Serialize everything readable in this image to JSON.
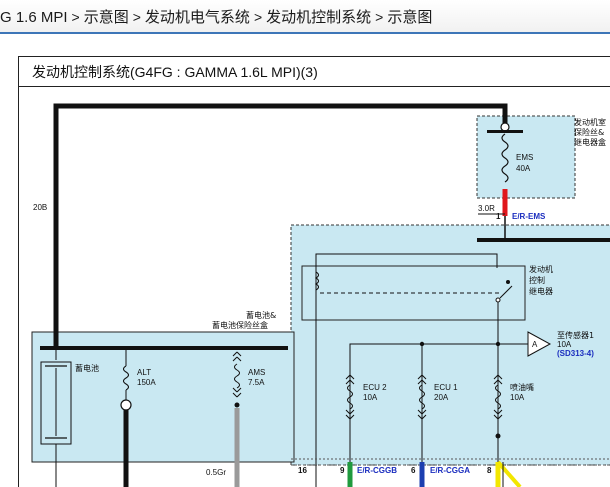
{
  "breadcrumb": {
    "items": [
      "G 1.6 MPI",
      "示意图",
      "发动机电气系统",
      "发动机控制系统",
      "示意图"
    ],
    "separator": ">"
  },
  "diagram": {
    "title": "发动机控制系统(G4FG : GAMMA 1.6L MPI)(3)",
    "wire_20b": "20B",
    "ems_box_label_l1": "发动机室",
    "ems_box_label_l2": "保险丝&",
    "ems_box_label_l3": "继电器盒",
    "ems_fuse_name": "EMS",
    "ems_fuse_rating": "40A",
    "ems_conn": "3.0R",
    "ems_pin": "1",
    "ems_wire": "E/R-EMS",
    "relay_label_l1": "发动机",
    "relay_label_l2": "控制",
    "relay_label_l3": "继电器",
    "sensor_label": "至传感器1",
    "sensor_rating": "10A",
    "sensor_ref": "(SD313-4)",
    "sensor_connector": "A",
    "battery_box_label_l1": "蓄电池&",
    "battery_box_label_l2": "蓄电池保险丝盒",
    "battery_label": "蓄电池",
    "alt_name": "ALT",
    "alt_rating": "150A",
    "ams_name": "AMS",
    "ams_rating": "7.5A",
    "ecu2_name": "ECU 2",
    "ecu2_rating": "10A",
    "ecu1_name": "ECU 1",
    "ecu1_rating": "20A",
    "injector_name": "喷油嘴",
    "injector_rating": "10A",
    "wire_05gr": "0.5Gr",
    "pin_16": "16",
    "pin_9": "9",
    "wire_cggb": "E/R-CGGB",
    "pin_6": "6",
    "wire_cgga": "E/R-CGGA",
    "pin_8": "8"
  },
  "colors": {
    "box_fill": "#c9e8f2",
    "box_dash": "#333333",
    "wire_black": "#111111",
    "wire_red": "#e0161b",
    "wire_green": "#1f9a3e",
    "wire_blue": "#1c3fb0",
    "wire_gray": "#9a9a9a",
    "wire_yellow": "#f2e600",
    "link_blue": "#1a2dbf",
    "breadcrumb_border": "#3d76b8"
  }
}
